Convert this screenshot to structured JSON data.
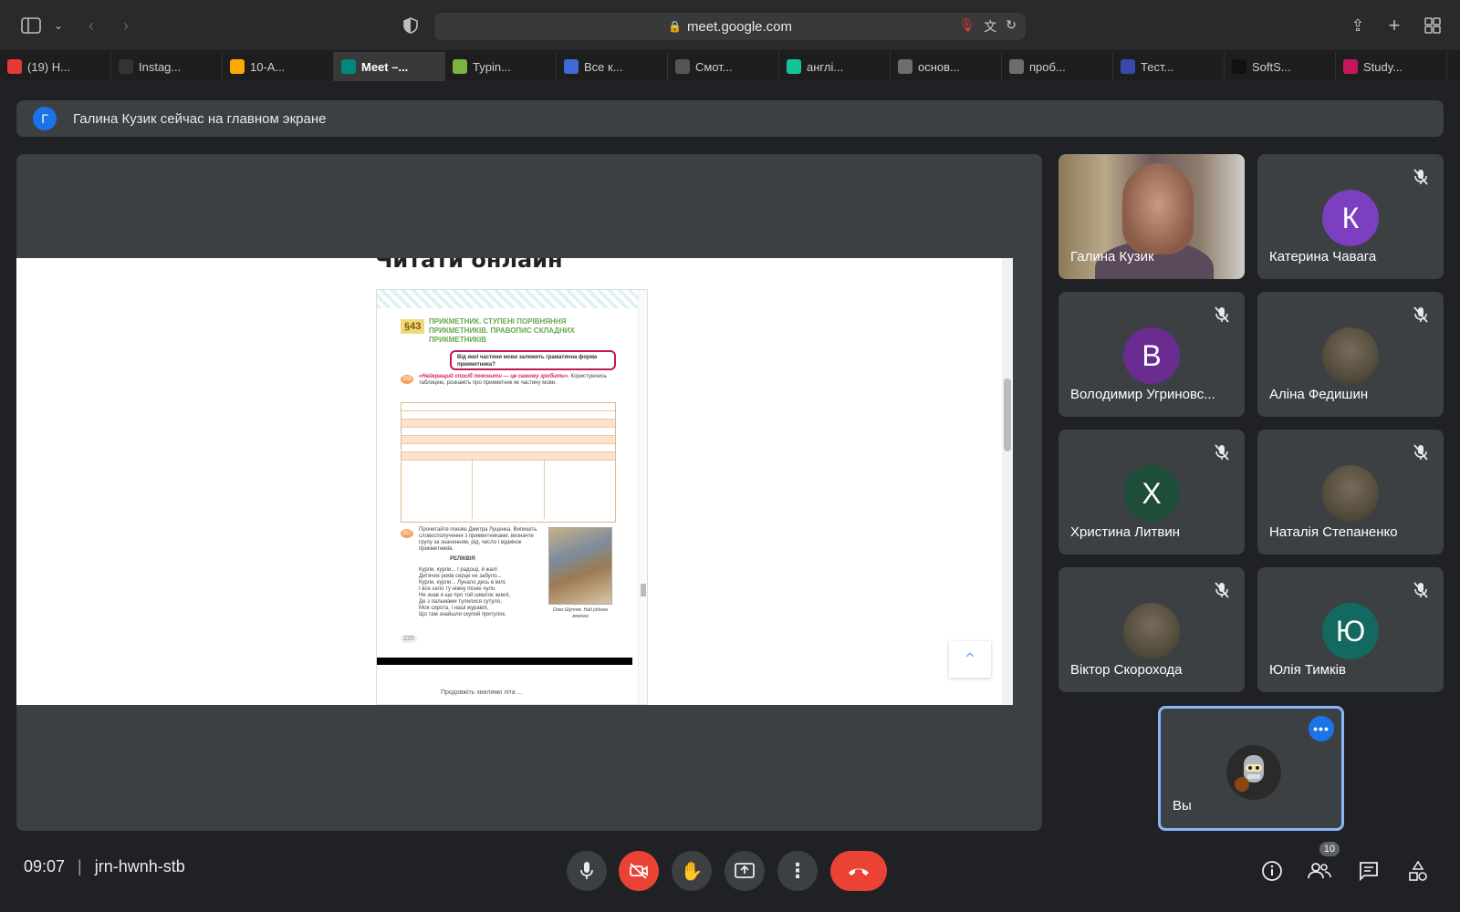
{
  "browser": {
    "url": "meet.google.com",
    "tabs": [
      {
        "label": "(19) Н...",
        "favicon": "youtube-icon",
        "color": "#e53935"
      },
      {
        "label": "Instag...",
        "favicon": "instagram-icon",
        "color": "#333333"
      },
      {
        "label": "10-А...",
        "favicon": "classroom-icon",
        "color": "#f9ab00"
      },
      {
        "label": "Meet –...",
        "favicon": "meet-icon",
        "color": "#00897b",
        "active": true
      },
      {
        "label": "Typin...",
        "favicon": "typing-icon",
        "color": "#7cb342"
      },
      {
        "label": "Все к...",
        "favicon": "fr-icon",
        "color": "#3f6ad8"
      },
      {
        "label": "Смот...",
        "favicon": "hd-icon",
        "color": "#555555"
      },
      {
        "label": "англі...",
        "favicon": "grammarly-icon",
        "color": "#15c39a"
      },
      {
        "label": "основ...",
        "favicon": "o-icon",
        "color": "#6d6d6d"
      },
      {
        "label": "проб...",
        "favicon": "o-icon",
        "color": "#6d6d6d"
      },
      {
        "label": "Тест...",
        "favicon": "iq-icon",
        "color": "#3949ab"
      },
      {
        "label": "SoftS...",
        "favicon": "s-icon",
        "color": "#111111"
      },
      {
        "label": "Study...",
        "favicon": "study-icon",
        "color": "#c2185b"
      }
    ]
  },
  "banner": {
    "avatar_letter": "Г",
    "text": "Галина Кузик сейчас на главном экране"
  },
  "presentation": {
    "page_heading": "Читати онлайн",
    "section": "§43",
    "book_title": "ПРИКМЕТНИК. СТУПЕНІ ПОРІВНЯННЯ ПРИКМЕТНИКІВ. ПРАВОПИС СКЛАДНИХ ПРИКМЕТНИКІВ",
    "question": "Від якої частини мови залежить граматична форма прикметника?",
    "exercise_356_num": "356",
    "exercise_356_quote": "«Найкращий спосіб пояснити — це самому зробити».",
    "exercise_356_text": "Користуючись таблицею, розкажіть про прикметник як частину мови.",
    "exercise_357_num": "357",
    "exercise_357_text": "Прочитайте поезію Дмитра Луценка. Випишіть словосполучення з прикметниками, визначте групу за значенням, рід, число і відмінок прикметників.",
    "poem_title": "РЕЛІКВІЯ",
    "poem_lines": [
      "Курли, курли... І радощі, й жалі",
      "Дитячих років серце не забуло...",
      "Курли, курли... Лунало десь в імлі,",
      "І все село ту ніжну пісню чуло.",
      "Не знав я ще про той шматок землі,",
      "Де з пальмами тулилися сутуло,",
      "Моя сирота, і наші журавлі,",
      "Що там знайшли скупий притулок."
    ],
    "photo_caption": "Олег Шупляк. Над рідною землею",
    "page_number": "220",
    "footer": "Продовжіть хвилями літа ..."
  },
  "participants": [
    {
      "name": "Галина Кузик",
      "type": "video",
      "muted": false
    },
    {
      "name": "Катерина Чавага",
      "letter": "К",
      "color": "#7b3fbf",
      "muted": true
    },
    {
      "name": "Володимир Угриновс...",
      "letter": "В",
      "color": "#6a2c91",
      "muted": true
    },
    {
      "name": "Аліна Федишин",
      "type": "photo",
      "muted": true
    },
    {
      "name": "Христина Литвин",
      "letter": "Х",
      "color": "#1e4d3a",
      "muted": true
    },
    {
      "name": "Наталія Степаненко",
      "type": "photo",
      "muted": true
    },
    {
      "name": "Віктор Скорохода",
      "type": "photo",
      "muted": true
    },
    {
      "name": "Юлія Тимків",
      "letter": "Ю",
      "color": "#13695f",
      "muted": true
    }
  ],
  "self_tile": {
    "name": "Вы"
  },
  "bottom_bar": {
    "time": "09:07",
    "meeting_code": "jrn-hwnh-stb",
    "participant_count": "10"
  }
}
